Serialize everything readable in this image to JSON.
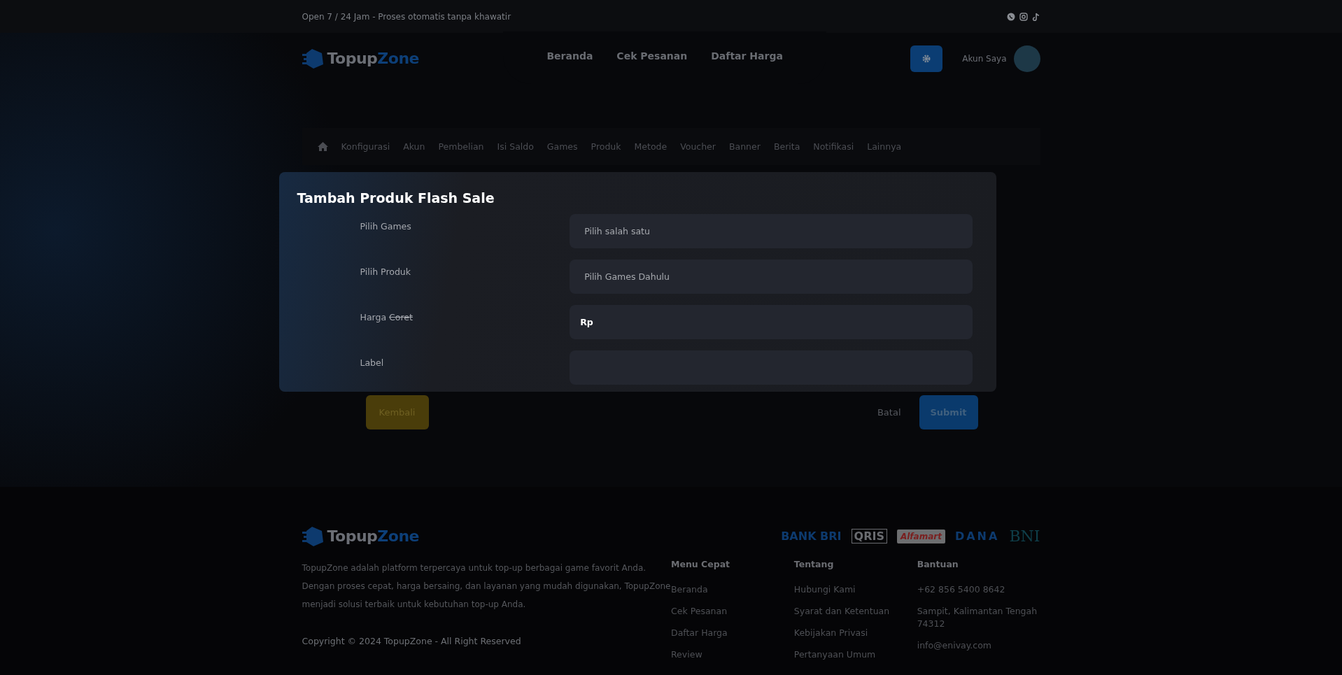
{
  "topbar": {
    "text": "Open 7 / 24 Jam - Proses otomatis tanpa khawatir"
  },
  "header": {
    "logo": {
      "first": "Topup",
      "second": "Zone"
    },
    "nav": [
      "Beranda",
      "Cek Pesanan",
      "Daftar Harga"
    ],
    "account": "Akun Saya"
  },
  "admin_menu": [
    "Konfigurasi",
    "Akun",
    "Pembelian",
    "Isi Saldo",
    "Games",
    "Produk",
    "Metode",
    "Voucher",
    "Banner",
    "Berita",
    "Notifikasi",
    "Lainnya"
  ],
  "modal": {
    "title": "Tambah Produk Flash Sale",
    "fields": [
      {
        "kind": "select",
        "label": "Pilih Games",
        "value": "Pilih salah satu"
      },
      {
        "kind": "select",
        "label": "Pilih Produk",
        "value": "Pilih Games Dahulu"
      },
      {
        "kind": "prefix",
        "label": "Harga",
        "struck": "Coret",
        "prefix": "Rp"
      },
      {
        "kind": "text",
        "label": "Label"
      }
    ]
  },
  "buttons": {
    "back": "Kembali",
    "cancel": "Batal",
    "submit": "Submit"
  },
  "footer": {
    "logo": {
      "first": "Topup",
      "second": "Zone"
    },
    "payments": [
      "BANK BRI",
      "QRIS",
      "Alfamart",
      "DANA",
      "BNI"
    ],
    "about": "TopupZone adalah platform terpercaya untuk top-up berbagai game favorit Anda. Dengan proses cepat, harga bersaing, dan layanan yang mudah digunakan, TopupZone menjadi solusi terbaik untuk kebutuhan top-up Anda.",
    "copyright": "Copyright © 2024 TopupZone - All Right Reserved",
    "columns": [
      {
        "title": "Menu Cepat",
        "links": [
          "Beranda",
          "Cek Pesanan",
          "Daftar Harga",
          "Review"
        ]
      },
      {
        "title": "Tentang",
        "links": [
          "Hubungi Kami",
          "Syarat dan Ketentuan",
          "Kebijakan Privasi",
          "Pertanyaan Umum"
        ]
      },
      {
        "title": "Bantuan",
        "links": [
          "+62 856 5400 8642",
          "Sampit, Kalimantan Tengah 74312",
          "info@enivay.com"
        ]
      }
    ]
  }
}
